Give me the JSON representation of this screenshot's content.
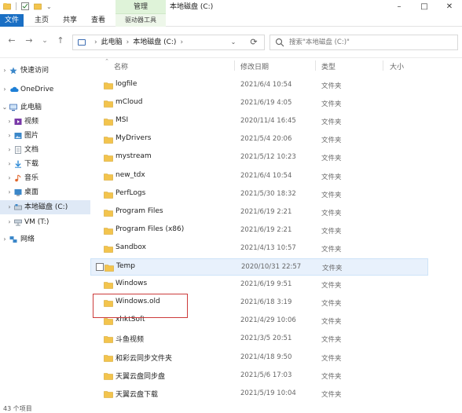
{
  "window": {
    "contextual_tab_group": "管理",
    "title": "本地磁盘 (C:)",
    "controls": {
      "minimize": "–",
      "maximize": "□",
      "close": "✕"
    }
  },
  "ribbon": {
    "tabs": [
      "文件",
      "主页",
      "共享",
      "查看"
    ],
    "contextual_tab": "驱动器工具"
  },
  "nav": {
    "back": "←",
    "forward": "→",
    "recent": "⌄",
    "up": "↑"
  },
  "address": {
    "crumbs": [
      "此电脑",
      "本地磁盘 (C:)"
    ],
    "separator": "›"
  },
  "search": {
    "placeholder": "搜索\"本地磁盘 (C:)\""
  },
  "navpane": {
    "items": [
      {
        "label": "快速访问",
        "icon": "star-icon",
        "color": "#f0b400"
      },
      {
        "label": "OneDrive",
        "icon": "cloud-icon",
        "color": "#1e7fd6"
      },
      {
        "label": "此电脑",
        "icon": "computer-icon",
        "color": "#3d6db3"
      },
      {
        "label": "视频",
        "icon": "video-icon",
        "color": "#7a3aa8"
      },
      {
        "label": "图片",
        "icon": "pictures-icon",
        "color": "#3b87c9"
      },
      {
        "label": "文档",
        "icon": "documents-icon",
        "color": "#7f8c99"
      },
      {
        "label": "下载",
        "icon": "download-icon",
        "color": "#2e8ad6"
      },
      {
        "label": "音乐",
        "icon": "music-icon",
        "color": "#e0662b"
      },
      {
        "label": "桌面",
        "icon": "desktop-icon",
        "color": "#3b87c9"
      },
      {
        "label": "本地磁盘 (C:)",
        "icon": "drive-icon",
        "color": "#6d7a88"
      },
      {
        "label": "VM (T:)",
        "icon": "network-drive-icon",
        "color": "#6d7a88"
      },
      {
        "label": "网络",
        "icon": "network-icon",
        "color": "#3b87c9"
      }
    ]
  },
  "columns": {
    "name": "名称",
    "date": "修改日期",
    "type": "类型",
    "size": "大小"
  },
  "files": [
    {
      "name": "logfile",
      "date": "2021/6/4 10:54",
      "type": "文件夹"
    },
    {
      "name": "mCloud",
      "date": "2021/6/19 4:05",
      "type": "文件夹"
    },
    {
      "name": "MSI",
      "date": "2020/11/4 16:45",
      "type": "文件夹"
    },
    {
      "name": "MyDrivers",
      "date": "2021/5/4 20:06",
      "type": "文件夹"
    },
    {
      "name": "mystream",
      "date": "2021/5/12 10:23",
      "type": "文件夹"
    },
    {
      "name": "new_tdx",
      "date": "2021/6/4 10:54",
      "type": "文件夹"
    },
    {
      "name": "PerfLogs",
      "date": "2021/5/30 18:32",
      "type": "文件夹"
    },
    {
      "name": "Program Files",
      "date": "2021/6/19 2:21",
      "type": "文件夹"
    },
    {
      "name": "Program Files (x86)",
      "date": "2021/6/19 2:21",
      "type": "文件夹"
    },
    {
      "name": "Sandbox",
      "date": "2021/4/13 10:57",
      "type": "文件夹"
    },
    {
      "name": "Temp",
      "date": "2020/10/31 22:57",
      "type": "文件夹"
    },
    {
      "name": "Windows",
      "date": "2021/6/19 9:51",
      "type": "文件夹"
    },
    {
      "name": "Windows.old",
      "date": "2021/6/18 3:19",
      "type": "文件夹"
    },
    {
      "name": "xhktSoft",
      "date": "2021/4/29 10:06",
      "type": "文件夹"
    },
    {
      "name": "斗鱼视频",
      "date": "2021/3/5 20:51",
      "type": "文件夹"
    },
    {
      "name": "和彩云同步文件夹",
      "date": "2021/4/18 9:50",
      "type": "文件夹"
    },
    {
      "name": "天翼云盘同步盘",
      "date": "2021/5/6 17:03",
      "type": "文件夹"
    },
    {
      "name": "天翼云盘下载",
      "date": "2021/5/19 10:04",
      "type": "文件夹"
    }
  ],
  "status": {
    "item_count": "43 个项目"
  },
  "colors": {
    "accent": "#1a6fc4",
    "folder": "#f3c44d",
    "highlight": "#cc3b3b"
  }
}
